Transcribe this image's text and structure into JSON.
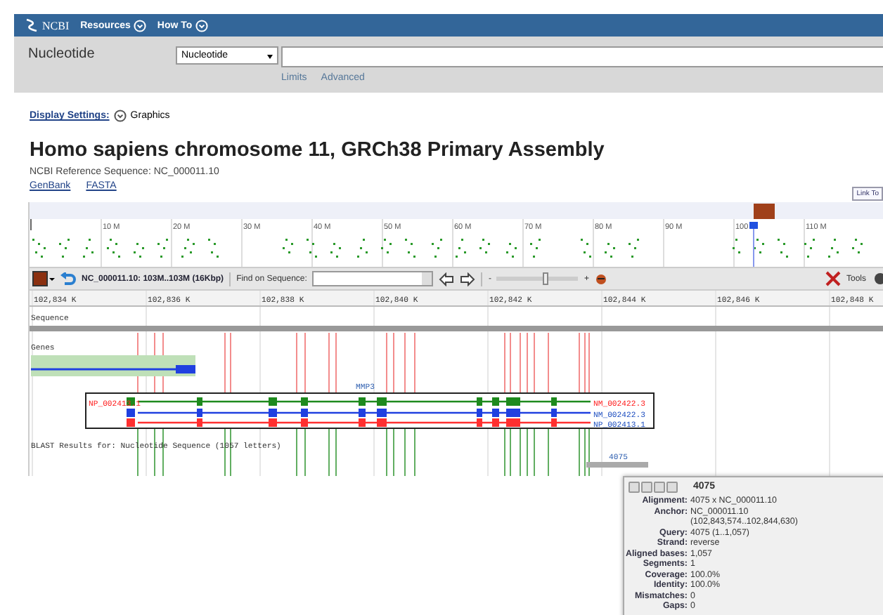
{
  "header": {
    "logo": "NCBI",
    "menus": [
      "Resources",
      "How To"
    ]
  },
  "search": {
    "database_label": "Nucleotide",
    "database": "Nucleotide",
    "links": [
      "Limits",
      "Advanced"
    ]
  },
  "display_settings": {
    "label": "Display Settings:",
    "value": "Graphics"
  },
  "title": "Homo sapiens chromosome 11, GRCh38 Primary Assembly",
  "reference": "NCBI Reference Sequence: NC_000011.10",
  "formats": [
    "GenBank",
    "FASTA"
  ],
  "link_to": "Link To",
  "overview": {
    "ticks": [
      "10 M",
      "20 M",
      "30 M",
      "40 M",
      "50 M",
      "60 M",
      "70 M",
      "80 M",
      "90 M",
      "100",
      "110 M"
    ]
  },
  "toolbar": {
    "location": "NC_000011.10: 103M..103M (16Kbp)",
    "find_label": "Find on Sequence:",
    "zoom_minus": "-",
    "zoom_plus": "+",
    "zoom_slider": {
      "level": 0.6
    },
    "tools": "Tools"
  },
  "ruler": [
    "102,834 K",
    "102,836 K",
    "102,838 K",
    "102,840 K",
    "102,842 K",
    "102,844 K",
    "102,846 K",
    "102,848 K"
  ],
  "tracks": [
    "Sequence",
    "Genes"
  ],
  "gene": {
    "name": "MMP3",
    "left_label": "NP_002413.1",
    "right_labels": [
      {
        "text": "NM_002422.3",
        "color": "#ff2020"
      },
      {
        "text": "NM_002422.3",
        "color": "#2050c0"
      },
      {
        "text": "NP_002413.1",
        "color": "#2050c0"
      }
    ]
  },
  "blast": {
    "title": "BLAST Results for: Nucleotide Sequence (1057 letters)",
    "hit": "4075"
  },
  "popup": {
    "title": "4075",
    "rows": [
      {
        "label": "Alignment:",
        "lines": [
          "4075 x NC_000011.10"
        ]
      },
      {
        "label": "Anchor:",
        "lines": [
          "NC_000011.10",
          "(102,843,574..102,844,630)"
        ]
      },
      {
        "label": "Query:",
        "lines": [
          "4075 (1..1,057)"
        ]
      },
      {
        "label": "Strand:",
        "lines": [
          "reverse"
        ]
      },
      {
        "label": "Aligned bases:",
        "lines": [
          "1,057"
        ]
      },
      {
        "label": "Segments:",
        "lines": [
          "1"
        ]
      },
      {
        "label": "Coverage:",
        "lines": [
          "100.0%"
        ]
      },
      {
        "label": "Identity:",
        "lines": [
          "100.0%"
        ]
      },
      {
        "label": "Mismatches:",
        "lines": [
          "0"
        ]
      },
      {
        "label": "Gaps:",
        "lines": [
          "0"
        ]
      }
    ]
  }
}
